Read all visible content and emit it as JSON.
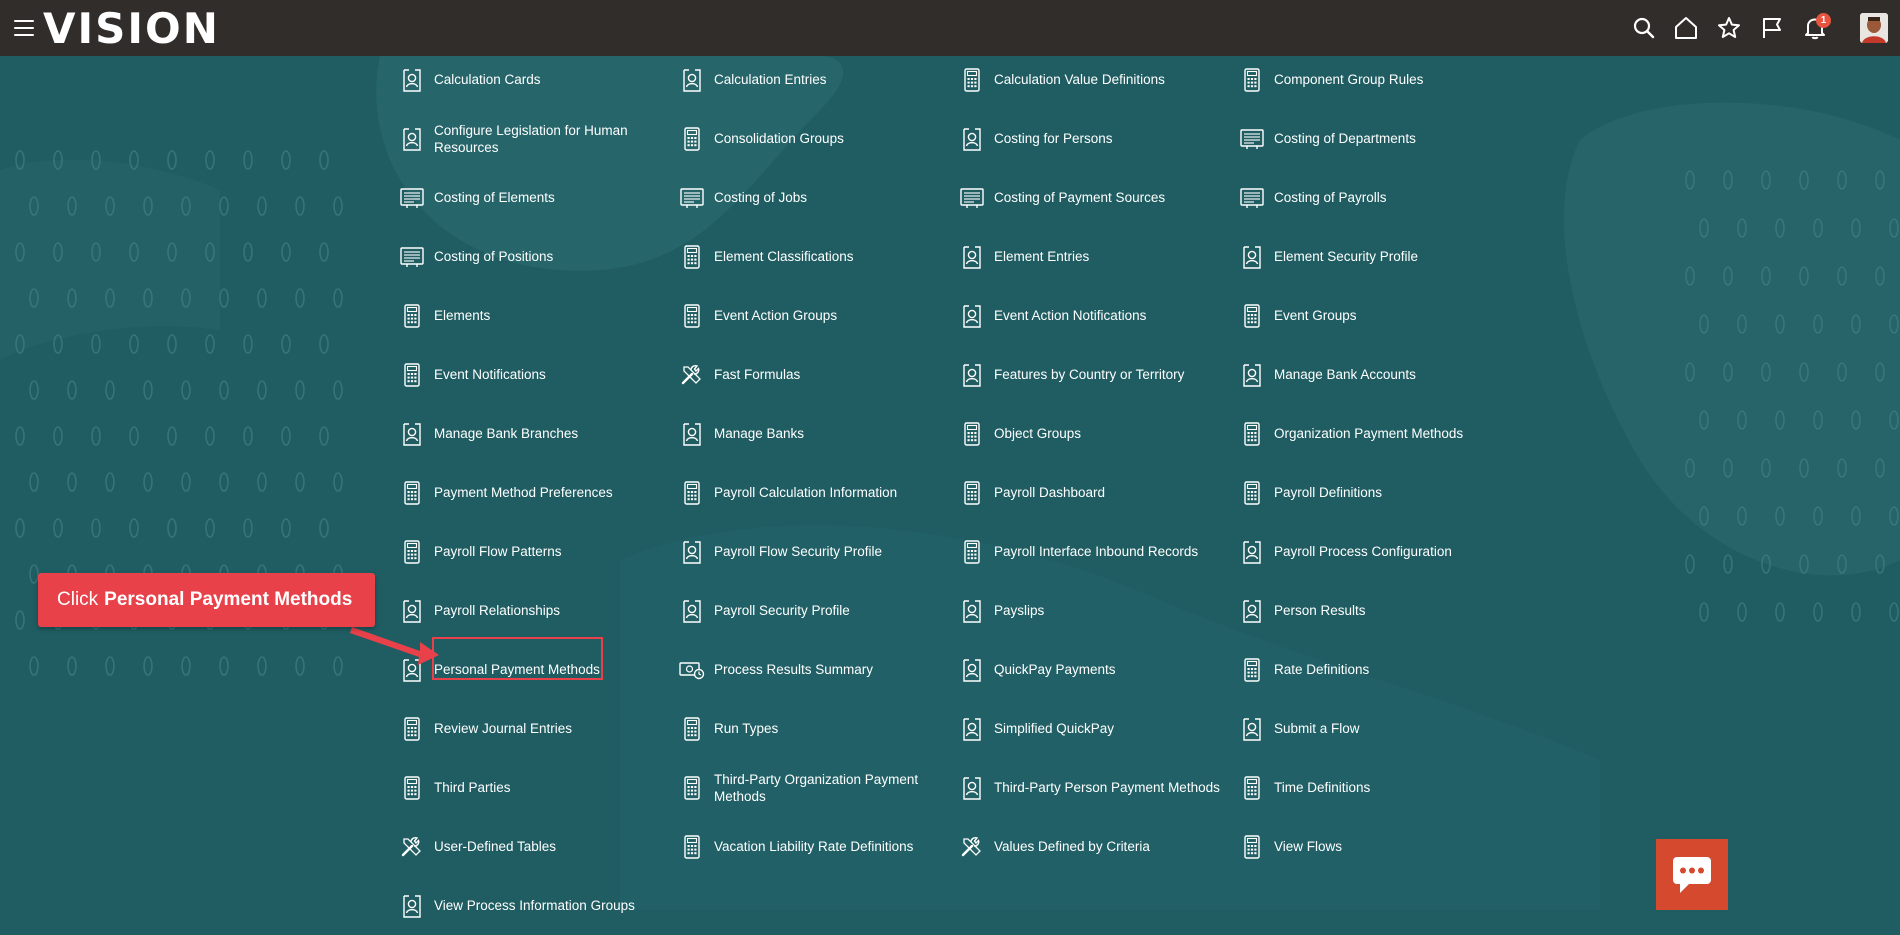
{
  "header": {
    "logo_text": "VISION",
    "notification_count": "1",
    "icons": [
      "menu-icon",
      "search-icon",
      "home-icon",
      "star-icon",
      "flag-icon",
      "bell-icon"
    ]
  },
  "colors": {
    "header_bg": "#312d2a",
    "page_bg": "#1f5d62",
    "callout_bg": "#e8414a",
    "chat_bg": "#d5492e",
    "badge_bg": "#e8543f"
  },
  "callout": {
    "prefix": "Click",
    "target": "Personal Payment Methods"
  },
  "tasks": [
    {
      "label": "Calculation Cards",
      "icon": "person-card"
    },
    {
      "label": "Calculation Entries",
      "icon": "person-card"
    },
    {
      "label": "Calculation Value Definitions",
      "icon": "calculator"
    },
    {
      "label": "Component Group Rules",
      "icon": "calculator"
    },
    {
      "label": "Configure Legislation for Human Resources",
      "icon": "person-card"
    },
    {
      "label": "Consolidation Groups",
      "icon": "calculator"
    },
    {
      "label": "Costing for Persons",
      "icon": "person-card"
    },
    {
      "label": "Costing of Departments",
      "icon": "ledger"
    },
    {
      "label": "Costing of Elements",
      "icon": "ledger"
    },
    {
      "label": "Costing of Jobs",
      "icon": "ledger"
    },
    {
      "label": "Costing of Payment Sources",
      "icon": "ledger"
    },
    {
      "label": "Costing of Payrolls",
      "icon": "ledger"
    },
    {
      "label": "Costing of Positions",
      "icon": "ledger"
    },
    {
      "label": "Element Classifications",
      "icon": "calculator"
    },
    {
      "label": "Element Entries",
      "icon": "person-card"
    },
    {
      "label": "Element Security Profile",
      "icon": "person-card"
    },
    {
      "label": "Elements",
      "icon": "calculator"
    },
    {
      "label": "Event Action Groups",
      "icon": "calculator"
    },
    {
      "label": "Event Action Notifications",
      "icon": "person-card"
    },
    {
      "label": "Event Groups",
      "icon": "calculator"
    },
    {
      "label": "Event Notifications",
      "icon": "calculator"
    },
    {
      "label": "Fast Formulas",
      "icon": "tools"
    },
    {
      "label": "Features by Country or Territory",
      "icon": "person-card"
    },
    {
      "label": "Manage Bank Accounts",
      "icon": "person-card"
    },
    {
      "label": "Manage Bank Branches",
      "icon": "person-card"
    },
    {
      "label": "Manage Banks",
      "icon": "person-card"
    },
    {
      "label": "Object Groups",
      "icon": "calculator"
    },
    {
      "label": "Organization Payment Methods",
      "icon": "calculator"
    },
    {
      "label": "Payment Method Preferences",
      "icon": "calculator"
    },
    {
      "label": "Payroll Calculation Information",
      "icon": "calculator"
    },
    {
      "label": "Payroll Dashboard",
      "icon": "calculator"
    },
    {
      "label": "Payroll Definitions",
      "icon": "calculator"
    },
    {
      "label": "Payroll Flow Patterns",
      "icon": "calculator"
    },
    {
      "label": "Payroll Flow Security Profile",
      "icon": "person-card"
    },
    {
      "label": "Payroll Interface Inbound Records",
      "icon": "calculator"
    },
    {
      "label": "Payroll Process Configuration",
      "icon": "person-card"
    },
    {
      "label": "Payroll Relationships",
      "icon": "person-card"
    },
    {
      "label": "Payroll Security Profile",
      "icon": "person-card"
    },
    {
      "label": "Payslips",
      "icon": "person-card"
    },
    {
      "label": "Person Results",
      "icon": "person-card"
    },
    {
      "label": "Personal Payment Methods",
      "icon": "person-card"
    },
    {
      "label": "Process Results Summary",
      "icon": "money"
    },
    {
      "label": "QuickPay Payments",
      "icon": "person-card"
    },
    {
      "label": "Rate Definitions",
      "icon": "calculator"
    },
    {
      "label": "Review Journal Entries",
      "icon": "calculator"
    },
    {
      "label": "Run Types",
      "icon": "calculator"
    },
    {
      "label": "Simplified QuickPay",
      "icon": "person-card"
    },
    {
      "label": "Submit a Flow",
      "icon": "person-card"
    },
    {
      "label": "Third Parties",
      "icon": "calculator"
    },
    {
      "label": "Third-Party Organization Payment Methods",
      "icon": "calculator"
    },
    {
      "label": "Third-Party Person Payment Methods",
      "icon": "person-card"
    },
    {
      "label": "Time Definitions",
      "icon": "calculator"
    },
    {
      "label": "User-Defined Tables",
      "icon": "tools"
    },
    {
      "label": "Vacation Liability Rate Definitions",
      "icon": "calculator"
    },
    {
      "label": "Values Defined by Criteria",
      "icon": "tools"
    },
    {
      "label": "View Flows",
      "icon": "calculator"
    },
    {
      "label": "View Process Information Groups",
      "icon": "person-card"
    }
  ]
}
